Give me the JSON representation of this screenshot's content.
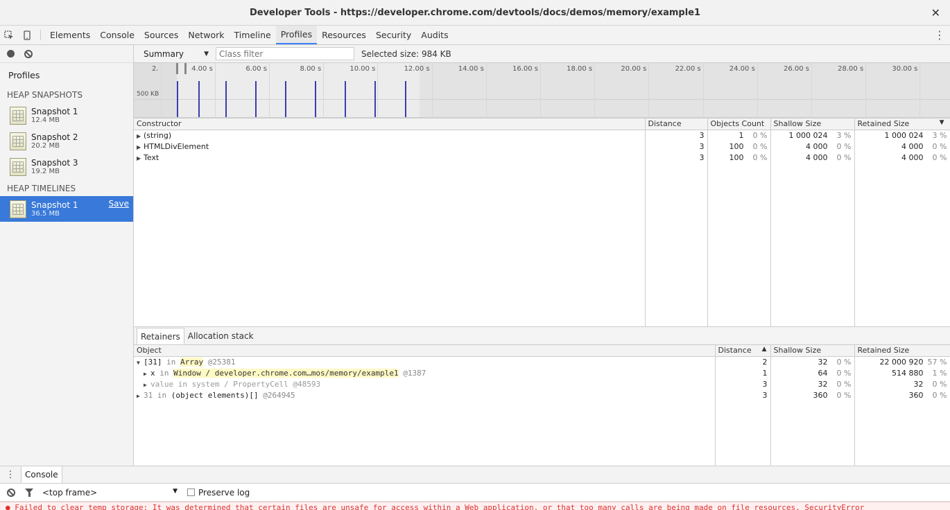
{
  "window": {
    "title": "Developer Tools - https://developer.chrome.com/devtools/docs/demos/memory/example1",
    "close_glyph": "✕"
  },
  "main_tabs": [
    {
      "label": "Elements"
    },
    {
      "label": "Console"
    },
    {
      "label": "Sources"
    },
    {
      "label": "Network"
    },
    {
      "label": "Timeline"
    },
    {
      "label": "Profiles"
    },
    {
      "label": "Resources"
    },
    {
      "label": "Security"
    },
    {
      "label": "Audits"
    }
  ],
  "sidebar": {
    "profiles_label": "Profiles",
    "heap_snapshots_label": "HEAP SNAPSHOTS",
    "heap_timelines_label": "HEAP TIMELINES",
    "snapshots": [
      {
        "name": "Snapshot 1",
        "size": "12.4 MB"
      },
      {
        "name": "Snapshot 2",
        "size": "20.2 MB"
      },
      {
        "name": "Snapshot 3",
        "size": "19.2 MB"
      }
    ],
    "timelines": [
      {
        "name": "Snapshot 1",
        "size": "36.5 MB",
        "save_label": "Save"
      }
    ]
  },
  "toolbar": {
    "view": "Summary",
    "class_filter_placeholder": "Class filter",
    "selected_size": "Selected size: 984 KB"
  },
  "timeline": {
    "ticks": [
      "2.",
      "4.00 s",
      "6.00 s",
      "8.00 s",
      "10.00 s",
      "12.00 s",
      "14.00 s",
      "16.00 s",
      "18.00 s",
      "20.00 s",
      "22.00 s",
      "24.00 s",
      "26.00 s",
      "28.00 s",
      "30.00 s"
    ],
    "y_label": "500 KB",
    "allocation_bars": [
      {
        "time_s": 2.6,
        "value": 0.5
      },
      {
        "time_s": 3.4,
        "value": 0.5
      },
      {
        "time_s": 4.4,
        "value": 0.5
      },
      {
        "time_s": 5.5,
        "value": 0.5
      },
      {
        "time_s": 6.6,
        "value": 0.5
      },
      {
        "time_s": 7.7,
        "value": 0.5
      },
      {
        "time_s": 8.8,
        "value": 0.5
      },
      {
        "time_s": 9.9,
        "value": 0.5
      },
      {
        "time_s": 11.0,
        "value": 0.5
      }
    ]
  },
  "summary_table": {
    "headers": {
      "constructor": "Constructor",
      "distance": "Distance",
      "objects_count": "Objects Count",
      "shallow_size": "Shallow Size",
      "retained_size": "Retained Size"
    },
    "sort_glyph": "▼",
    "rows": [
      {
        "constructor": "(string)",
        "distance": "3",
        "count": "1",
        "count_pct": "0 %",
        "shallow": "1 000 024",
        "shallow_pct": "3 %",
        "retained": "1 000 024",
        "retained_pct": "3 %"
      },
      {
        "constructor": "HTMLDivElement",
        "distance": "3",
        "count": "100",
        "count_pct": "0 %",
        "shallow": "4 000",
        "shallow_pct": "0 %",
        "retained": "4 000",
        "retained_pct": "0 %"
      },
      {
        "constructor": "Text",
        "distance": "3",
        "count": "100",
        "count_pct": "0 %",
        "shallow": "4 000",
        "shallow_pct": "0 %",
        "retained": "4 000",
        "retained_pct": "0 %"
      }
    ]
  },
  "retainers": {
    "tabs": [
      {
        "label": "Retainers"
      },
      {
        "label": "Allocation stack"
      }
    ],
    "headers": {
      "object": "Object",
      "distance": "Distance",
      "shallow_size": "Shallow Size",
      "retained_size": "Retained Size"
    },
    "sort_glyph": "▲",
    "rows": [
      {
        "prefix": "[31]",
        "in": "in",
        "target": "Array",
        "id": "@25381",
        "distance": "2",
        "shallow": "32",
        "shallow_pct": "0 %",
        "retained": "22 000 920",
        "retained_pct": "57 %"
      },
      {
        "prefix": "x",
        "in": "in",
        "target": "Window / developer.chrome.com…mos/memory/example1",
        "id": "@1387",
        "distance": "1",
        "shallow": "64",
        "shallow_pct": "0 %",
        "retained": "514 880",
        "retained_pct": "1 %"
      },
      {
        "prefix": "value",
        "in": "in",
        "target": "system / PropertyCell",
        "id": "@48593",
        "distance": "3",
        "shallow": "32",
        "shallow_pct": "0 %",
        "retained": "32",
        "retained_pct": "0 %"
      },
      {
        "prefix": "31",
        "in": "in",
        "target": "(object elements)[]",
        "id": "@264945",
        "distance": "3",
        "shallow": "360",
        "shallow_pct": "0 %",
        "retained": "360",
        "retained_pct": "0 %"
      }
    ]
  },
  "drawer": {
    "tab_label": "Console",
    "frame": "<top frame>",
    "preserve_log": "Preserve log",
    "error": "Failed to clear temp storage: It was determined that certain files are unsafe for access within a Web application, or that too many calls are being made on file resources. SecurityError"
  },
  "colors": {
    "accent": "#3e82f7",
    "selection": "#3879d9",
    "allocation_bar": "#3b3bb0",
    "error": "#e03030"
  }
}
